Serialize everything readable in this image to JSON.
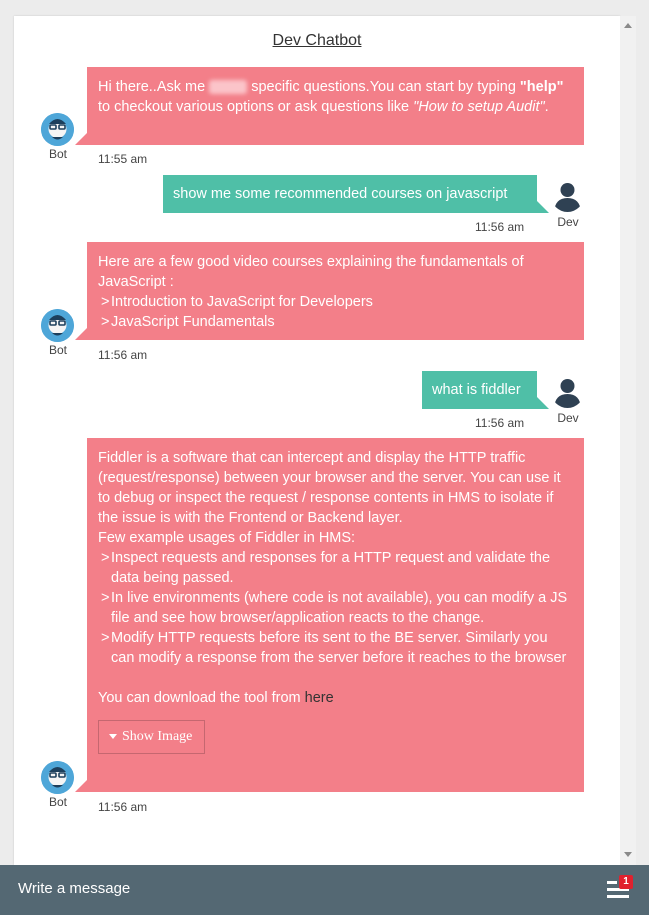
{
  "app": {
    "title": "Dev Chatbot"
  },
  "messages": [
    {
      "sender": "Bot",
      "time": "11:55 am",
      "parts": {
        "a": "Hi there..Ask me",
        "b": "specific questions.You can start by typing",
        "help": "\"help\"",
        "c": "to checkout various options or ask questions like",
        "example": "\"How to setup Audit\"",
        "end": "."
      }
    },
    {
      "sender": "Dev",
      "time": "11:56 am",
      "text": "show me some recommended courses on javascript"
    },
    {
      "sender": "Bot",
      "time": "11:56 am",
      "intro": "Here are a few good video courses explaining the fundamentals of JavaScript :",
      "items": [
        "Introduction to JavaScript for Developers",
        "JavaScript Fundamentals"
      ]
    },
    {
      "sender": "Dev",
      "time": "11:56 am",
      "text": "what is fiddler"
    },
    {
      "sender": "Bot",
      "time": "11:56 am",
      "intro": "Fiddler is a software that can intercept and display the HTTP traffic (request/response) between your browser and the server. You can use it to debug or inspect the request / response contents in HMS to isolate if the issue is with the Frontend or Backend layer.",
      "subhead": "Few example usages of Fiddler in HMS:",
      "items": [
        "Inspect requests and responses for a HTTP request and validate the data being passed.",
        "In live environments (where code is not available), you can modify a JS file and see how browser/application reacts to the change.",
        "Modify HTTP requests before its sent to the BE server. Similarly you can modify a response from the server before it reaches to the browser"
      ],
      "download_text": "You can download the tool from",
      "download_link": "here",
      "button_label": "Show Image"
    }
  ],
  "composer": {
    "placeholder": "Write a message",
    "badge_count": "1"
  },
  "colors": {
    "bot_bubble": "#f37f89",
    "user_bubble": "#4fbfa7",
    "footer": "#546873",
    "avatar": "#4ea6d8",
    "badge": "#e0212e"
  }
}
